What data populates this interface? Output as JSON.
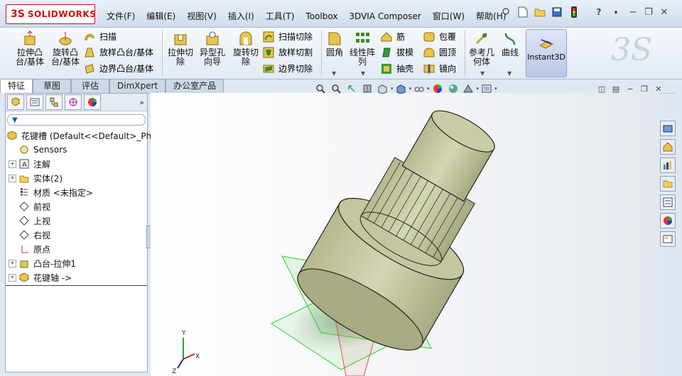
{
  "app": {
    "logo_mark": "3S",
    "logo_text": "SOLIDWORKS"
  },
  "menu": [
    "文件(F)",
    "编辑(E)",
    "视图(V)",
    "插入(I)",
    "工具(T)",
    "Toolbox",
    "3DVIA Composer",
    "窗口(W)",
    "帮助(H)"
  ],
  "ribbon": {
    "extrude_boss": "拉伸凸\n台/基体",
    "revolve_boss": "旋转凸\n台/基体",
    "sweep": "扫描",
    "loft_boss": "放样凸台/基体",
    "boundary_boss": "边界凸台/基体",
    "extrude_cut": "拉伸切\n除",
    "hole_wizard": "异型孔\n向导",
    "revolve_cut": "旋转切\n除",
    "swept_cut": "扫描切除",
    "lofted_cut": "放样切割",
    "boundary_cut": "边界切除",
    "fillet": "圆角",
    "linear_pattern": "线性阵\n列",
    "rib": "筋",
    "draft": "拔模",
    "shell": "抽壳",
    "wrap": "包覆",
    "dome": "圆顶",
    "mirror": "镜向",
    "ref_geometry": "参考几\n何体",
    "curves": "曲线",
    "instant3d": "Instant3D"
  },
  "tabs": [
    "特征",
    "草图",
    "评估",
    "DimXpert",
    "办公室产品"
  ],
  "tree": {
    "root": "花键槽  (Default<<Default>_Ph",
    "items": [
      {
        "label": "Sensors",
        "expandable": false,
        "icon": "sensor-icon"
      },
      {
        "label": "注解",
        "expandable": true,
        "icon": "annotation-icon"
      },
      {
        "label": "实体(2)",
        "expandable": true,
        "icon": "solid-bodies-icon"
      },
      {
        "label": "材质 <未指定>",
        "expandable": false,
        "icon": "material-icon"
      },
      {
        "label": "前视",
        "expandable": false,
        "icon": "plane-icon"
      },
      {
        "label": "上视",
        "expandable": false,
        "icon": "plane-icon"
      },
      {
        "label": "右视",
        "expandable": false,
        "icon": "plane-icon"
      },
      {
        "label": "原点",
        "expandable": false,
        "icon": "origin-icon"
      },
      {
        "label": "凸台-拉伸1",
        "expandable": true,
        "icon": "extrude-feature-icon"
      },
      {
        "label": "花键轴 ->",
        "expandable": true,
        "icon": "part-icon"
      }
    ]
  },
  "fm_expand": "»",
  "triad": {
    "x": "X",
    "y": "Y",
    "z": "Z"
  },
  "watermark": "3S",
  "colors": {
    "accent_red": "#c11818",
    "part_fill": "#c6c9a6",
    "plane_green": "#2bd12b"
  }
}
